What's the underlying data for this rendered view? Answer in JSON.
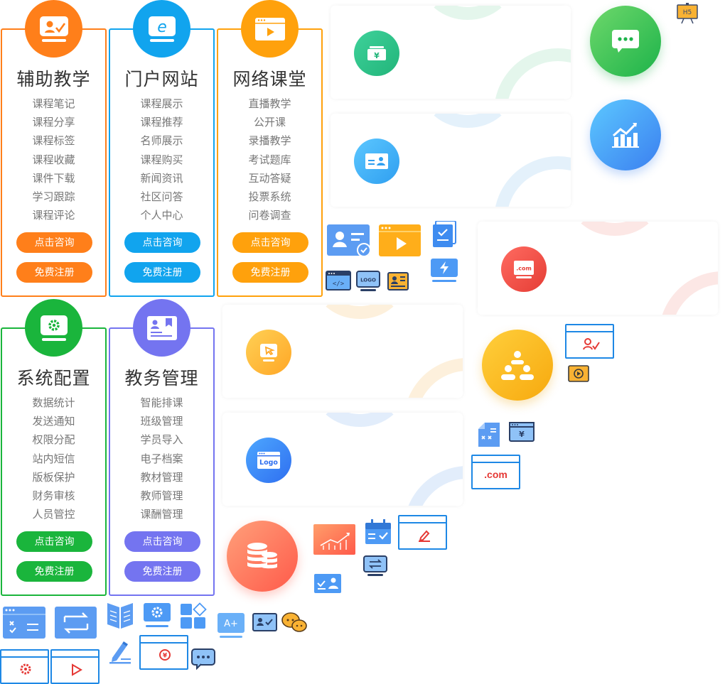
{
  "cards": [
    {
      "title": "辅助教学",
      "color": "#ff7f1a",
      "items": [
        "课程笔记",
        "课程分享",
        "课程标签",
        "课程收藏",
        "课件下载",
        "学习跟踪",
        "课程评论"
      ],
      "consult": "点击咨询",
      "register": "免费注册"
    },
    {
      "title": "门户网站",
      "color": "#11a4ee",
      "items": [
        "课程展示",
        "课程推荐",
        "名师展示",
        "课程购买",
        "新闻资讯",
        "社区问答",
        "个人中心"
      ],
      "consult": "点击咨询",
      "register": "免费注册"
    },
    {
      "title": "网络课堂",
      "color": "#ffa10c",
      "items": [
        "直播教学",
        "公开课",
        "录播教学",
        "考试题库",
        "互动答疑",
        "投票系统",
        "问卷调查"
      ],
      "consult": "点击咨询",
      "register": "免费注册"
    },
    {
      "title": "系统配置",
      "color": "#1ab53c",
      "items": [
        "数据统计",
        "发送通知",
        "权限分配",
        "站内短信",
        "版板保护",
        "财务审核",
        "人员管控"
      ],
      "consult": "点击咨询",
      "register": "免费注册"
    },
    {
      "title": "教务管理",
      "color": "#7474f0",
      "items": [
        "智能排课",
        "班级管理",
        "学员导入",
        "电子档案",
        "教材管理",
        "教师管理",
        "课酬管理"
      ],
      "consult": "点击咨询",
      "register": "免费注册"
    }
  ],
  "icons": {
    "h5": "H5",
    "logo_small": "LOGO",
    "logo_large": "Logo",
    "dotcom_small": ".com",
    "dotcom_frame": ".com",
    "grade": "A+",
    "yen": "¥"
  },
  "colors": {
    "frame_blue": "#1e88e5",
    "frame_red": "#e53935"
  }
}
